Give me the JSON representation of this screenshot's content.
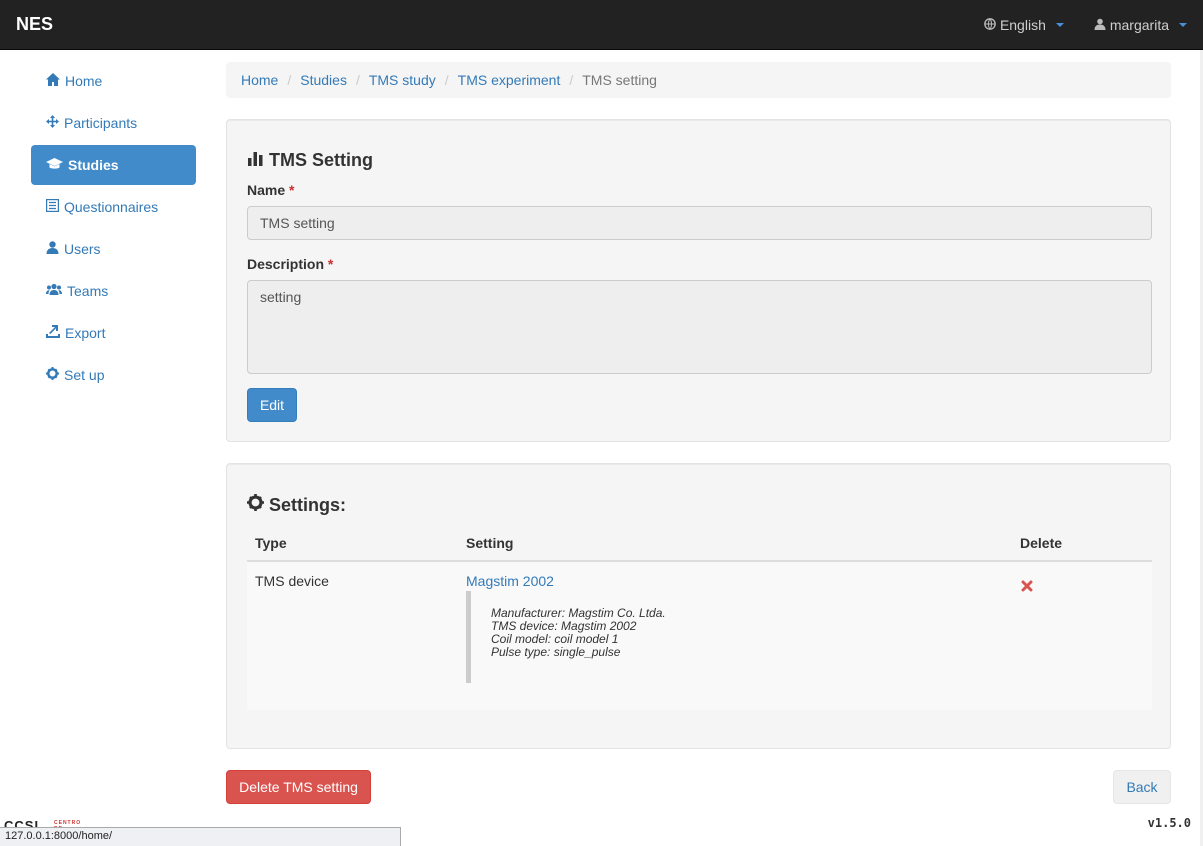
{
  "app": {
    "brand": "NES",
    "version": "v1.5.0",
    "status_url": "127.0.0.1:8000/home/"
  },
  "nav": {
    "language": "English",
    "user": "margarita"
  },
  "sidebar": {
    "items": [
      {
        "label": "Home",
        "icon": "home-icon"
      },
      {
        "label": "Participants",
        "icon": "move-icon"
      },
      {
        "label": "Studies",
        "icon": "education-icon",
        "active": true
      },
      {
        "label": "Questionnaires",
        "icon": "list-alt-icon"
      },
      {
        "label": "Users",
        "icon": "user-icon"
      },
      {
        "label": "Teams",
        "icon": "group-icon"
      },
      {
        "label": "Export",
        "icon": "export-icon"
      },
      {
        "label": "Set up",
        "icon": "cog-icon"
      }
    ]
  },
  "breadcrumb": {
    "items": [
      "Home",
      "Studies",
      "TMS study",
      "TMS experiment"
    ],
    "current": "TMS setting"
  },
  "tms_setting": {
    "title": "TMS Setting",
    "name_label": "Name",
    "name_value": "TMS setting",
    "description_label": "Description",
    "description_value": "setting",
    "required_mark": "*",
    "edit_label": "Edit"
  },
  "settings": {
    "title": "Settings:",
    "headers": {
      "type": "Type",
      "setting": "Setting",
      "delete": "Delete"
    },
    "rows": [
      {
        "type": "TMS device",
        "setting": "Magstim 2002",
        "details": [
          "Manufacturer: Magstim Co. Ltda.",
          "TMS device: Magstim 2002",
          "Coil model: coil model 1",
          "Pulse type: single_pulse"
        ],
        "delete_icon": "remove-icon"
      }
    ]
  },
  "actions": {
    "delete_label": "Delete TMS setting",
    "back_label": "Back"
  },
  "colors": {
    "primary": "#428bca",
    "danger": "#d9534f",
    "navbar": "#222222",
    "link": "#337ab7",
    "delete_x": "#d9534f"
  }
}
